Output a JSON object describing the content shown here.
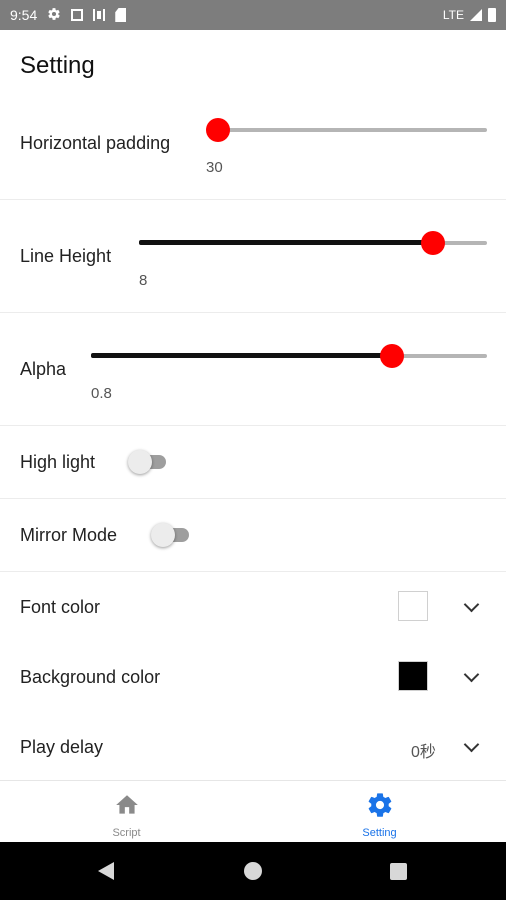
{
  "status_bar": {
    "time": "9:54",
    "network": "LTE",
    "icons": [
      "gear-icon",
      "sd-card-icon",
      "vibrate-icon",
      "sim-card-icon",
      "signal-icon",
      "battery-icon"
    ]
  },
  "page": {
    "title": "Setting"
  },
  "settings": {
    "horizontal_padding": {
      "label": "Horizontal padding",
      "value": "30",
      "fraction": 0.0
    },
    "line_height": {
      "label": "Line Height",
      "value": "8",
      "fraction": 0.845
    },
    "alpha": {
      "label": "Alpha",
      "value": "0.8",
      "fraction": 0.76
    },
    "high_light": {
      "label": "High light",
      "on": false
    },
    "mirror_mode": {
      "label": "Mirror Mode",
      "on": false
    },
    "font_color": {
      "label": "Font color",
      "color": "#ffffff"
    },
    "background_color": {
      "label": "Background color",
      "color": "#000000"
    },
    "play_delay": {
      "label": "Play delay",
      "value": "0秒"
    }
  },
  "tabs": [
    {
      "label": "Script",
      "icon": "home-icon",
      "active": false
    },
    {
      "label": "Setting",
      "icon": "gear-icon",
      "active": true
    }
  ],
  "colors": {
    "accent": "#1a73e8",
    "slider_thumb": "#ff0000",
    "inactive_tab": "#8a8a8a"
  }
}
